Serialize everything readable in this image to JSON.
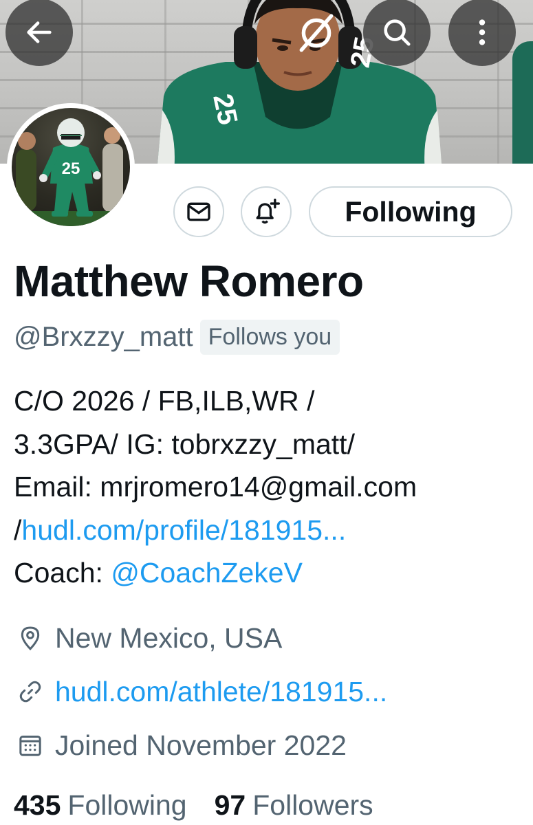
{
  "header": {
    "back_icon": "arrow-left-icon",
    "grok_icon": "grok-icon",
    "search_icon": "search-icon",
    "more_icon": "more-vertical-icon",
    "banner_jersey_number": "25"
  },
  "avatar": {
    "jersey_number": "25"
  },
  "actions": {
    "message_icon": "mail-icon",
    "notify_icon": "bell-plus-icon",
    "follow_label": "Following"
  },
  "profile": {
    "name": "Matthew Romero",
    "handle": "@Brxzzy_matt",
    "follows_you": "Follows you",
    "bio": {
      "line1": "C/O 2026 / FB,ILB,WR /",
      "line2": "3.3GPA/ IG: tobrxzzy_matt/",
      "line3": "Email: mrjromero14@gmail.com",
      "line4_prefix": "/",
      "line4_link": "hudl.com/profile/181915...",
      "line5_prefix": "Coach: ",
      "line5_mention": "@CoachZekeV"
    },
    "location": "New Mexico, USA",
    "website": "hudl.com/athlete/181915...",
    "joined": "Joined November 2022",
    "following_count": "435",
    "following_label": "Following",
    "followers_count": "97",
    "followers_label": "Followers"
  },
  "colors": {
    "link": "#1d9bf0",
    "secondary_text": "#536471",
    "primary_text": "#0f1419",
    "jersey_green": "#1d7a5f"
  }
}
